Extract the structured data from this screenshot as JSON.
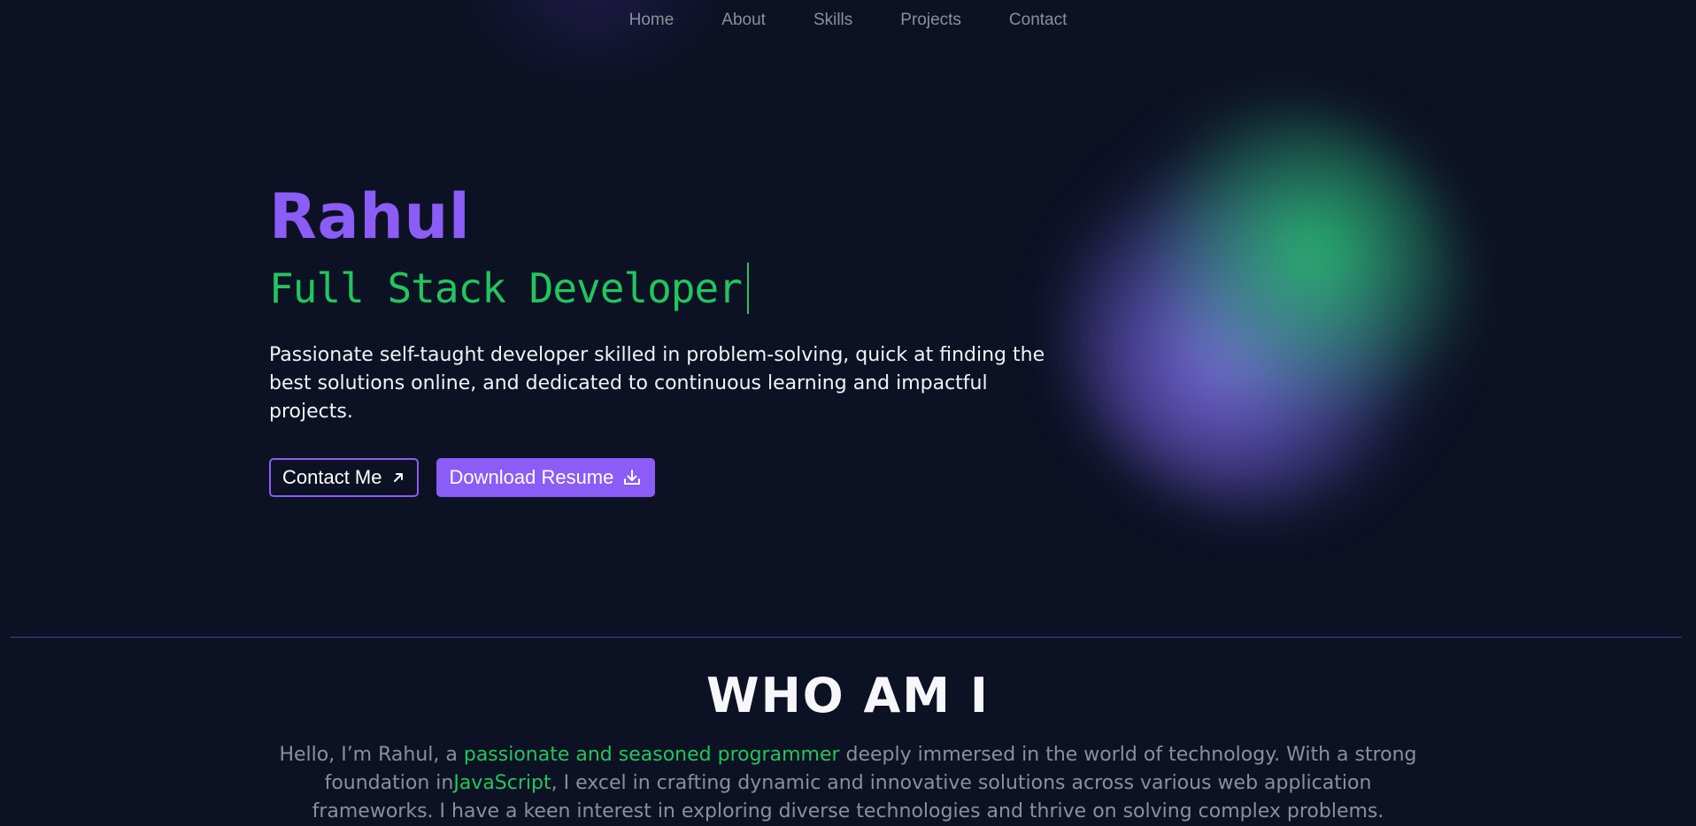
{
  "nav": {
    "items": [
      {
        "label": "Home"
      },
      {
        "label": "About"
      },
      {
        "label": "Skills"
      },
      {
        "label": "Projects"
      },
      {
        "label": "Contact"
      }
    ]
  },
  "hero": {
    "name": "Rahul",
    "role": "Full Stack Developer",
    "description": "Passionate self-taught developer skilled in problem-solving, quick at finding the best solutions online, and dedicated to continuous learning and impactful projects.",
    "contact_button": "Contact Me",
    "resume_button": "Download Resume"
  },
  "about": {
    "title": "WHO AM I",
    "intro": "Hello, I’m Rahul, a ",
    "highlight1": "passionate and seasoned programmer",
    "mid": " deeply immersed in the world of technology. With a strong foundation in",
    "highlight2": "JavaScript",
    "rest": ", I excel in crafting dynamic and innovative solutions across various web application frameworks. I have a keen interest in exploring diverse technologies and thrive on solving complex problems."
  },
  "colors": {
    "background": "#0d1124",
    "accent_purple": "#8b5cf6",
    "accent_green": "#22c55e",
    "muted_text": "#8a8f9c",
    "divider": "#4b3d9a"
  },
  "icons": {
    "contact": "arrow-up-right-icon",
    "resume": "download-icon"
  }
}
